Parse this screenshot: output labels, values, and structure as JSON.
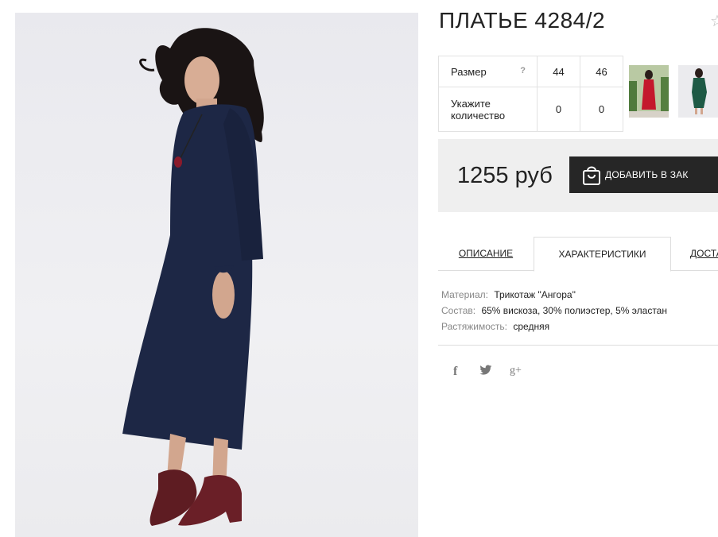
{
  "product": {
    "title": "ПЛАТЬЕ 4284/2",
    "price": "1255 руб",
    "add_to_cart_label": "ДОБАВИТЬ В ЗАК"
  },
  "size_table": {
    "size_label": "Размер",
    "help_mark": "?",
    "quantity_label_line1": "Укажите",
    "quantity_label_line2": "количество",
    "sizes": [
      "44",
      "46"
    ],
    "quantities": [
      "0",
      "0"
    ]
  },
  "tabs": {
    "description": "ОПИСАНИЕ",
    "characteristics": "ХАРАКТЕРИСТИКИ",
    "delivery": "ДОСТА"
  },
  "specs": [
    {
      "key": "Материал:",
      "value": "Трикотаж \"Ангора\""
    },
    {
      "key": "Состав:",
      "value": "65% вискоза, 30% полиэстер, 5% эластан"
    },
    {
      "key": "Растяжимость:",
      "value": "средняя"
    }
  ],
  "social": {
    "facebook": "f",
    "twitter": "🐦",
    "googleplus": "g+"
  },
  "colors": {
    "dress": "#1d2745",
    "button": "#262626",
    "panel": "#efefef"
  }
}
